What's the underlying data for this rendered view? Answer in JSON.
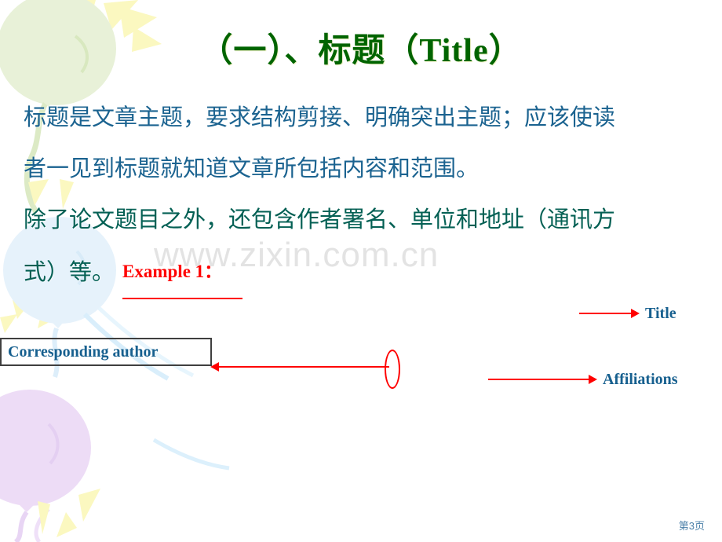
{
  "slide": {
    "page_number": "第3页",
    "background_color": "#ffffff"
  },
  "watermark": {
    "text": "www.zixin.com.cn",
    "color": "#e3e3e3"
  },
  "title": {
    "text": "（一）、标题（Title）",
    "color": "#006400"
  },
  "body": {
    "lines": [
      {
        "text": "标题是文章主题，要求结构剪接、明确突出主题；应该使读",
        "color": "#1b6390"
      },
      {
        "text": "者一见到标题就知道文章所包括内容和范围。",
        "color": "#1b6390"
      },
      {
        "text": "除了论文题目之外，还包含作者署名、单位和地址（通讯方",
        "color": "#046054"
      },
      {
        "text": "式）等。",
        "color": "#046054"
      }
    ],
    "example_label": "Example 1："
  },
  "annotations": {
    "title_label": "Title",
    "affiliations_label": "Affiliations",
    "corresponding_author_label": "Corresponding author",
    "arrow_color": "#ff0000",
    "label_color": "#17608f",
    "box_border_color": "#3f3f3f"
  },
  "decorations": {
    "balloon_green_color": "#e4efd2",
    "balloon_blue_color": "#e3f1fa",
    "balloon_purple_color": "#ecdcf5",
    "ray_color": "#fbf8c0",
    "swoosh_color": "#d6ecfa"
  }
}
